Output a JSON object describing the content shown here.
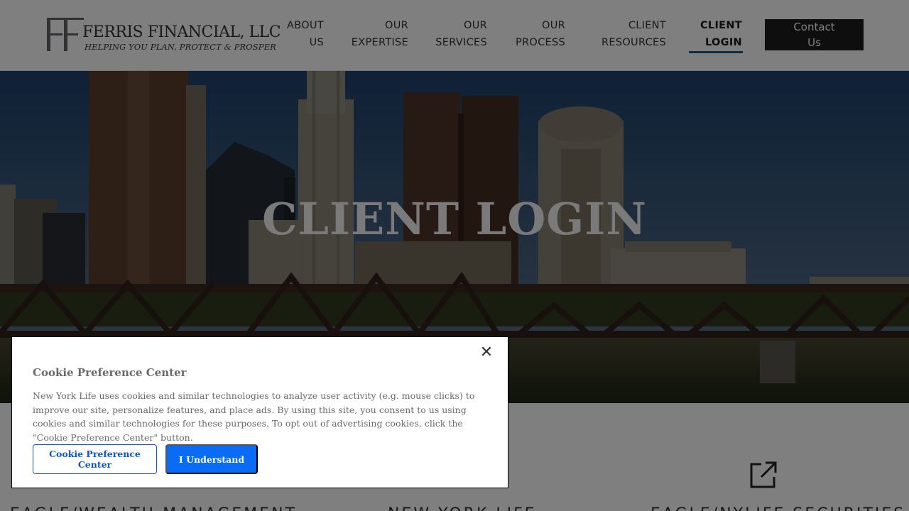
{
  "brand": {
    "name": "FERRIS FINANCIAL, LLC",
    "tagline": "HELPING YOU PLAN, PROTECT & PROSPER"
  },
  "nav": {
    "items": [
      {
        "label": "ABOUT\nUS",
        "active": false
      },
      {
        "label": "OUR\nEXPERTISE",
        "active": false
      },
      {
        "label": "OUR\nSERVICES",
        "active": false
      },
      {
        "label": "OUR\nPROCESS",
        "active": false
      },
      {
        "label": "CLIENT\nRESOURCES",
        "active": false
      },
      {
        "label": "CLIENT\nLOGIN",
        "active": true
      }
    ],
    "contact_label": "Contact\nUs"
  },
  "hero": {
    "title": "CLIENT LOGIN"
  },
  "links": {
    "items": [
      {
        "title": "EAGLE/WEALTH MANAGEMENT",
        "icon": "external-link-icon"
      },
      {
        "title": "NEW YORK LIFE",
        "icon": "external-link-icon"
      },
      {
        "title": "EAGLE/NYLIFE SECURITIES",
        "icon": "external-link-icon"
      }
    ]
  },
  "cookie_modal": {
    "close_glyph": "✕",
    "title": "Cookie Preference Center",
    "body": "New York Life uses cookies and similar technologies to analyze user activity (e.g. mouse clicks) to improve our site, personalize features, and place ads. By using this site, you consent to us using cookies and similar technologies for these purposes. To opt out of advertising cookies, click the \"Cookie Preference Center\" button.",
    "preference_button": "Cookie Preference Center",
    "accept_button": "I Understand"
  },
  "colors": {
    "accent": "#1e5a8a",
    "contact_bg": "#1c1c1c",
    "primary_button": "#0a6cf5",
    "outline_button": "#0b57c9"
  }
}
